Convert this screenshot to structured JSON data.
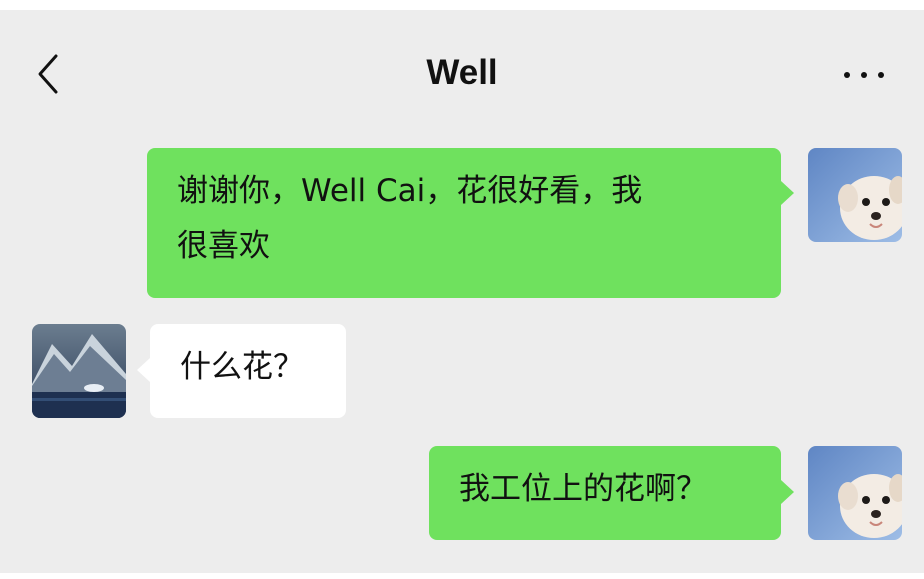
{
  "header": {
    "title": "Well",
    "back_icon": "chevron-left-icon",
    "more_icon": "more-dots-icon"
  },
  "messages": [
    {
      "sender": "me",
      "lines": [
        "谢谢你，Well Cai，花很好看，我",
        "很喜欢"
      ]
    },
    {
      "sender": "other",
      "lines": [
        "什么花？"
      ]
    },
    {
      "sender": "me",
      "lines": [
        "我工位上的花啊？"
      ]
    }
  ],
  "colors": {
    "background": "#ededed",
    "my_bubble": "#6fe15e",
    "their_bubble": "#ffffff",
    "text": "#111111"
  }
}
